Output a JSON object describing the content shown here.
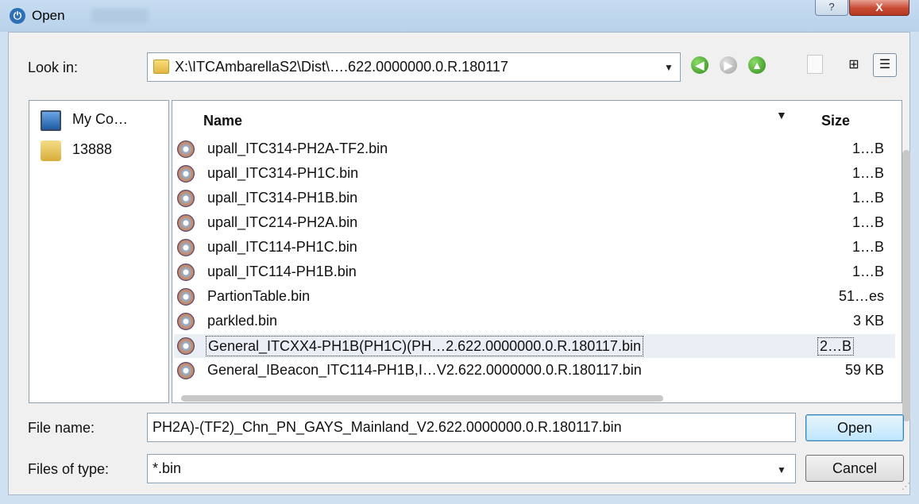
{
  "window": {
    "title": "Open",
    "help_label": "?",
    "close_label": "X"
  },
  "lookin": {
    "label": "Look in:",
    "path": "X:\\ITCAmbarellaS2\\Dist\\….622.0000000.0.R.180117"
  },
  "toolbar": {
    "back_icon": "back-arrow-icon",
    "forward_icon": "forward-arrow-icon",
    "up_icon": "up-folder-icon",
    "new_folder_icon": "new-folder-icon",
    "list_view_icon": "list-view-icon",
    "details_view_icon": "details-view-icon"
  },
  "places": [
    {
      "label": "My Co…",
      "icon": "computer-icon"
    },
    {
      "label": "13888",
      "icon": "user-folder-icon"
    }
  ],
  "filelist": {
    "columns": {
      "name": "Name",
      "size": "Size"
    },
    "rows": [
      {
        "name": "upall_ITC314-PH2A-TF2.bin",
        "size": "1…B"
      },
      {
        "name": "upall_ITC314-PH1C.bin",
        "size": "1…B"
      },
      {
        "name": "upall_ITC314-PH1B.bin",
        "size": "1…B"
      },
      {
        "name": "upall_ITC214-PH2A.bin",
        "size": "1…B"
      },
      {
        "name": "upall_ITC114-PH1C.bin",
        "size": "1…B"
      },
      {
        "name": "upall_ITC114-PH1B.bin",
        "size": "1…B"
      },
      {
        "name": "PartionTable.bin",
        "size": "51…es"
      },
      {
        "name": "parkled.bin",
        "size": "3 KB"
      },
      {
        "name": "General_ITCXX4-PH1B(PH1C)(PH…2.622.0000000.0.R.180117.bin",
        "size": "2…B"
      },
      {
        "name": "General_IBeacon_ITC114-PH1B,I…V2.622.0000000.0.R.180117.bin",
        "size": "59 KB"
      }
    ]
  },
  "filename": {
    "label": "File name:",
    "value": "PH2A)-(TF2)_Chn_PN_GAYS_Mainland_V2.622.0000000.0.R.180117.bin"
  },
  "filetype": {
    "label": "Files of type:",
    "value": "*.bin"
  },
  "buttons": {
    "open": "Open",
    "cancel": "Cancel"
  }
}
